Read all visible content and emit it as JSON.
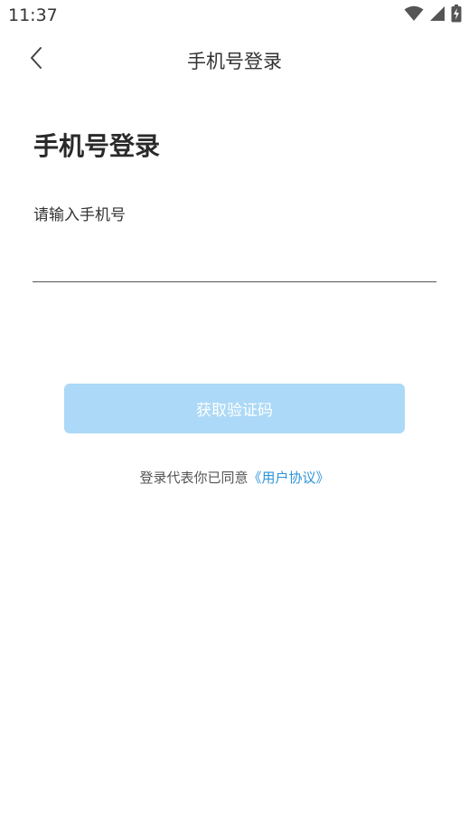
{
  "status_bar": {
    "time": "11:37",
    "icons": [
      "wifi-icon",
      "signal-icon",
      "battery-charging-icon"
    ]
  },
  "nav": {
    "title": "手机号登录",
    "back_icon": "chevron-left-icon"
  },
  "main": {
    "heading": "手机号登录",
    "phone_label": "请输入手机号",
    "phone_value": "",
    "button_label": "获取验证码",
    "agreement_prefix": "登录代表你已同意",
    "agreement_link": "《用户协议》"
  },
  "colors": {
    "button_disabled": "#acd9f7",
    "link": "#2d93d8",
    "background": "#ffffff"
  }
}
